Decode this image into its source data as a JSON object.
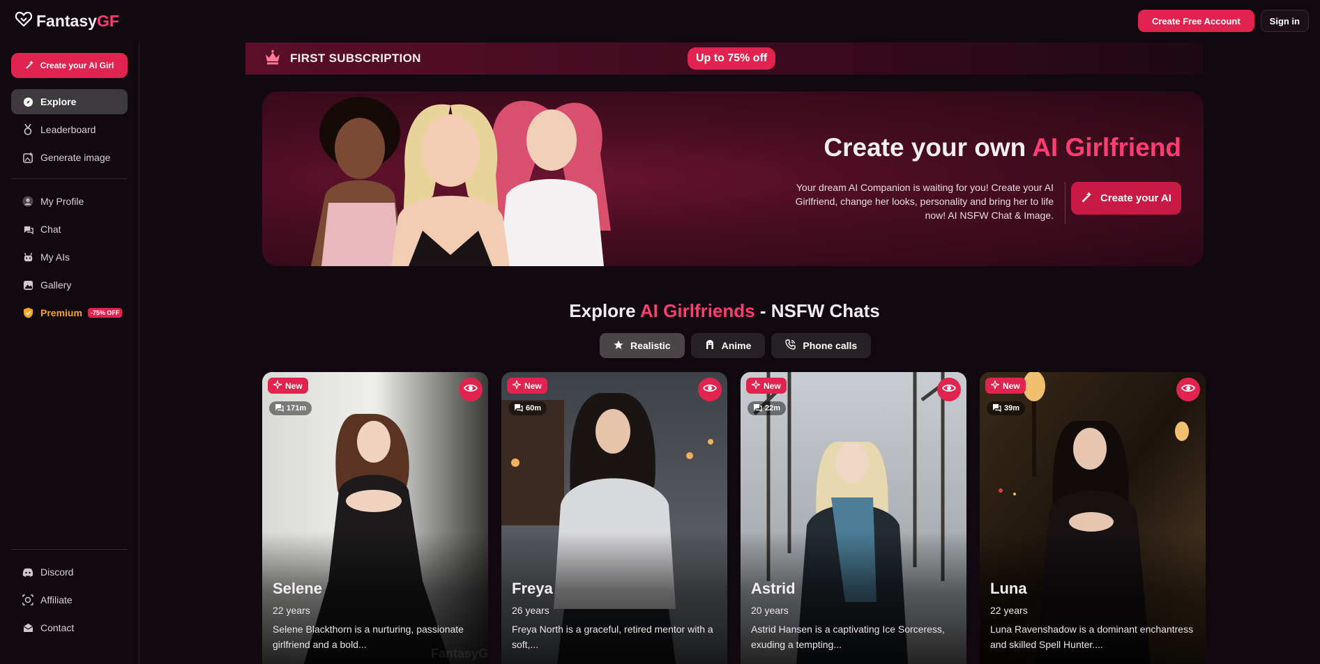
{
  "header": {
    "logo_text": "Fantasy",
    "logo_accent": "GF",
    "create_account": "Create Free Account",
    "sign_in": "Sign in"
  },
  "sidebar": {
    "create_button": "Create your AI Girl",
    "items": [
      {
        "label": "Explore",
        "icon": "compass-icon",
        "active": true
      },
      {
        "label": "Leaderboard",
        "icon": "medal-icon"
      },
      {
        "label": "Generate image",
        "icon": "image-plus-icon"
      }
    ],
    "account_items": [
      {
        "label": "My Profile",
        "icon": "user-icon"
      },
      {
        "label": "Chat",
        "icon": "chat-icon"
      },
      {
        "label": "My AIs",
        "icon": "bot-icon"
      },
      {
        "label": "Gallery",
        "icon": "gallery-icon"
      }
    ],
    "premium": {
      "label": "Premium",
      "badge": "-75% OFF",
      "icon": "shield-icon"
    },
    "bottom_items": [
      {
        "label": "Discord",
        "icon": "discord-icon"
      },
      {
        "label": "Affiliate",
        "icon": "affiliate-icon"
      },
      {
        "label": "Contact",
        "icon": "mail-icon"
      }
    ]
  },
  "promo": {
    "title": "FIRST SUBSCRIPTION",
    "badge": "Up to 75% off"
  },
  "hero": {
    "title_prefix": "Create your own ",
    "title_accent": "AI Girlfriend",
    "description": "Your dream AI Companion is waiting for you! Create your AI Girlfriend, change her looks, personality and bring her to life now! AI NSFW Chat & Image.",
    "button": "Create your AI"
  },
  "explore": {
    "title_prefix": "Explore ",
    "title_accent": "AI Girlfriends",
    "title_suffix": " - NSFW Chats",
    "tabs": [
      {
        "label": "Realistic",
        "icon": "star-icon",
        "active": true
      },
      {
        "label": "Anime",
        "icon": "anime-icon"
      },
      {
        "label": "Phone calls",
        "icon": "phone-icon"
      }
    ]
  },
  "cards": [
    {
      "badge": "New",
      "messages": "171m",
      "name": "Selene",
      "age": "22 years",
      "description": "Selene Blackthorn is a nurturing, passionate girlfriend and a bold...",
      "watermark": "FantasyG"
    },
    {
      "badge": "New",
      "messages": "60m",
      "name": "Freya",
      "age": "26 years",
      "description": "Freya North is a graceful, retired mentor with a soft,..."
    },
    {
      "badge": "New",
      "messages": "22m",
      "name": "Astrid",
      "age": "20 years",
      "description": "Astrid Hansen is a captivating Ice Sorceress, exuding a tempting..."
    },
    {
      "badge": "New",
      "messages": "39m",
      "name": "Luna",
      "age": "22 years",
      "description": "Luna Ravenshadow is a dominant enchantress and skilled Spell Hunter...."
    }
  ],
  "colors": {
    "accent": "#e0244f",
    "accent_text": "#ff3d72",
    "background": "#12080f",
    "premium": "#f5a623"
  }
}
